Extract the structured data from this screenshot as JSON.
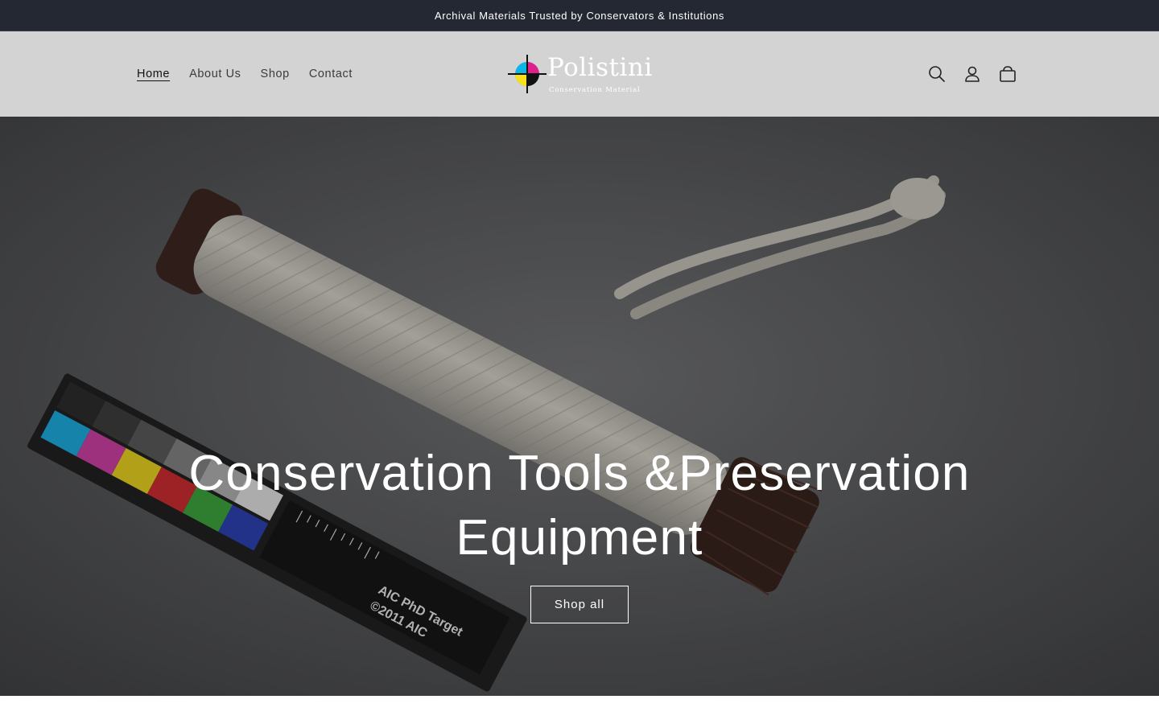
{
  "announcement": {
    "text": "Archival Materials Trusted by Conservators & Institutions"
  },
  "nav": {
    "items": [
      {
        "label": "Home",
        "active": true
      },
      {
        "label": "About Us",
        "active": false
      },
      {
        "label": "Shop",
        "active": false
      },
      {
        "label": "Contact",
        "active": false
      }
    ]
  },
  "logo": {
    "name": "Polistini",
    "tagline": "Conservation Material"
  },
  "header_icons": [
    "search-icon",
    "account-icon",
    "cart-icon"
  ],
  "hero": {
    "title": "Conservation Tools &Preservation Equipment",
    "button_label": "Shop all",
    "image_text": [
      "AIC PhD Target",
      "©2011 AIC"
    ]
  },
  "colors": {
    "announcement_bg": "#242833",
    "header_bg": "#d3d3d3",
    "hero_overlay": "rgba(0,0,0,0.18)",
    "text": "#121212"
  }
}
